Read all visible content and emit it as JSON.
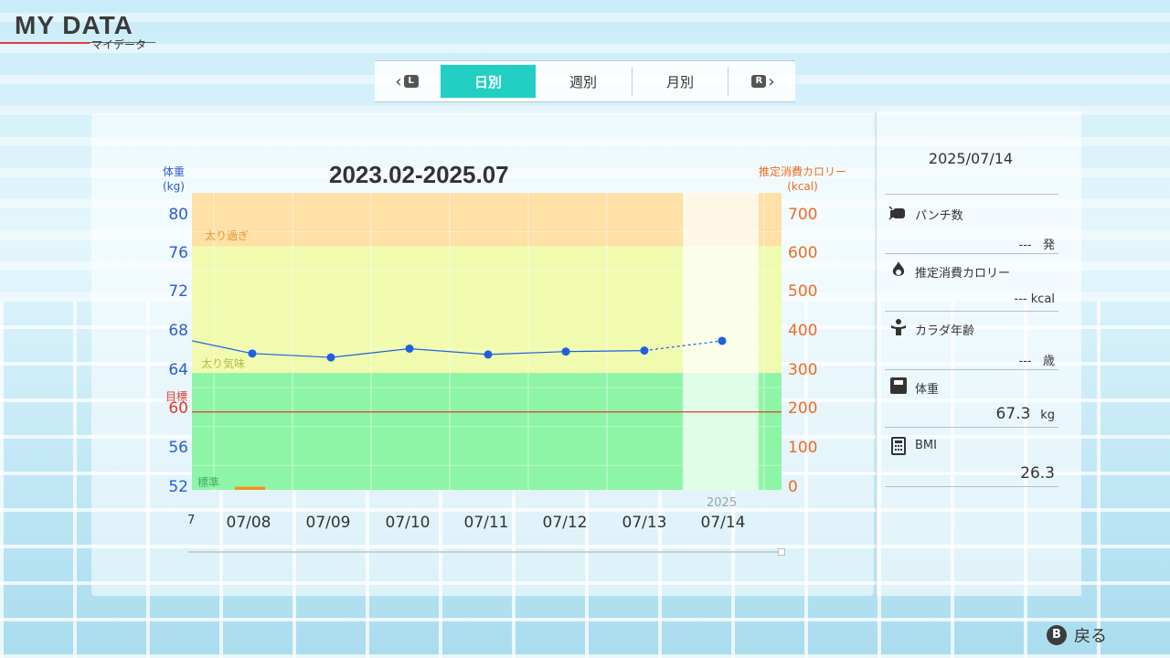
{
  "header": {
    "title": "MY DATA",
    "subtitle": "マイデータ"
  },
  "tabs": {
    "prev_key": "L",
    "next_key": "R",
    "items": [
      {
        "label": "日別",
        "active": true
      },
      {
        "label": "週別",
        "active": false
      },
      {
        "label": "月別",
        "active": false
      }
    ]
  },
  "chart": {
    "title": "2023.02-2025.07",
    "left_axis_label_line1": "体重",
    "left_axis_label_line2": "(kg)",
    "right_axis_label_line1": "推定消費カロリー",
    "right_axis_label_line2": "(kcal)",
    "goal_label": "目標",
    "year_label": "2025",
    "cut_tick": "7",
    "zones": {
      "over": "太り過ぎ",
      "slightly_over": "太り気味",
      "standard": "標準"
    }
  },
  "chart_data": {
    "type": "line",
    "x": [
      "07/08",
      "07/09",
      "07/10",
      "07/11",
      "07/12",
      "07/13",
      "07/14"
    ],
    "series": [
      {
        "values": [
          66.0,
          65.6,
          66.5,
          65.9,
          66.2,
          66.3,
          67.3
        ],
        "color": "#1f5fe0"
      }
    ],
    "left_ticks": [
      "80",
      "76",
      "72",
      "68",
      "64",
      "60",
      "56",
      "52"
    ],
    "right_ticks": [
      "700",
      "600",
      "500",
      "400",
      "300",
      "200",
      "100",
      "0"
    ],
    "ylim_weight": [
      52,
      82.5
    ],
    "ylim_kcal": [
      0,
      762
    ],
    "goal_weight": 60,
    "zone_bounds": {
      "standard_max": 64,
      "slightly_over_max": 77
    },
    "bar_calories": {
      "x": "07/07",
      "value": 8,
      "color": "#f7901e"
    },
    "colors": {
      "over": "#ffe0a6",
      "slightly_over": "#f0fbaf",
      "standard": "#8ef5a6",
      "goal": "#e23b30"
    }
  },
  "side": {
    "date": "2025/07/14",
    "stats": [
      {
        "label": "パンチ数",
        "value": "---",
        "unit": "発",
        "icon": "punch-icon"
      },
      {
        "label": "推定消費カロリー",
        "value": "---",
        "unit": "kcal",
        "icon": "flame-icon"
      },
      {
        "label": "カラダ年齢",
        "value": "---",
        "unit": "歳",
        "icon": "body-icon"
      },
      {
        "label": "体重",
        "value": "67.3",
        "unit": "kg",
        "icon": "scale-icon"
      },
      {
        "label": "BMI",
        "value": "26.3",
        "unit": "",
        "icon": "calculator-icon"
      }
    ]
  },
  "footer": {
    "back_key": "B",
    "back_label": "戻る"
  }
}
